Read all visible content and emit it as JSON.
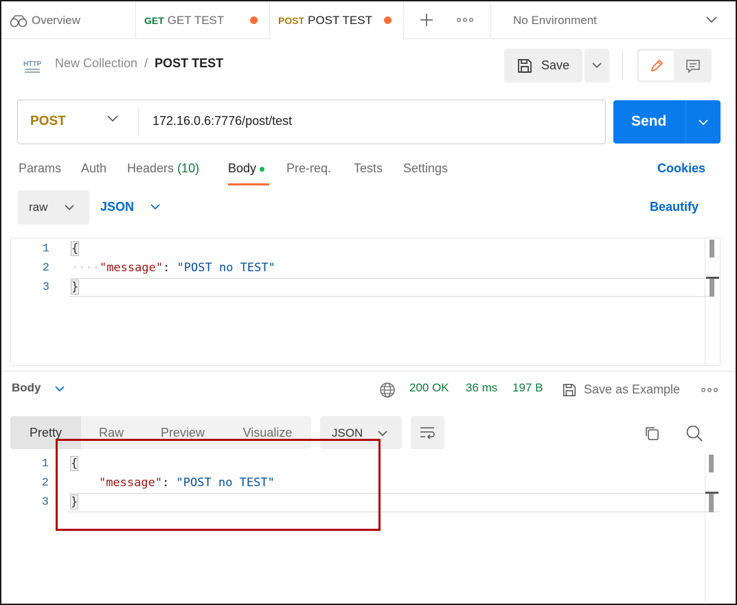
{
  "tabs": {
    "overview": "Overview",
    "get_method": "GET",
    "get_name": "GET TEST",
    "post_method": "POST",
    "post_name": "POST TEST",
    "environment": "No Environment"
  },
  "breadcrumb": {
    "parent": "New Collection",
    "separator": "/",
    "current": "POST TEST",
    "http_badge": "HTTP"
  },
  "toolbar": {
    "save_label": "Save"
  },
  "request": {
    "method": "POST",
    "url": "172.16.0.6:7776/post/test",
    "send_label": "Send"
  },
  "request_tabs": {
    "params": "Params",
    "auth": "Auth",
    "headers": "Headers",
    "headers_count": "(10)",
    "body": "Body",
    "prereq": "Pre-req.",
    "tests": "Tests",
    "settings": "Settings",
    "cookies": "Cookies"
  },
  "body_options": {
    "mode": "raw",
    "language": "JSON",
    "beautify": "Beautify"
  },
  "request_body": {
    "line_numbers": [
      "1",
      "2",
      "3"
    ],
    "open": "{",
    "key": "\"message\"",
    "colon": ": ",
    "value": "\"POST no TEST\"",
    "close": "}"
  },
  "response": {
    "section_label": "Body",
    "status": "200 OK",
    "time": "36 ms",
    "size": "197 B",
    "save_example": "Save as Example",
    "views": [
      "Pretty",
      "Raw",
      "Preview",
      "Visualize"
    ],
    "format": "JSON",
    "line_numbers": [
      "1",
      "2",
      "3"
    ],
    "open": "{",
    "key": "\"message\"",
    "colon": ": ",
    "value": "\"POST no TEST\"",
    "close": "}"
  },
  "colors": {
    "accent_orange": "#ff6c37",
    "send_blue": "#097bed",
    "link_blue": "#0265d2",
    "post_gold": "#ad7a03",
    "get_green": "#0c7a3b",
    "highlight_red": "#b00000"
  }
}
